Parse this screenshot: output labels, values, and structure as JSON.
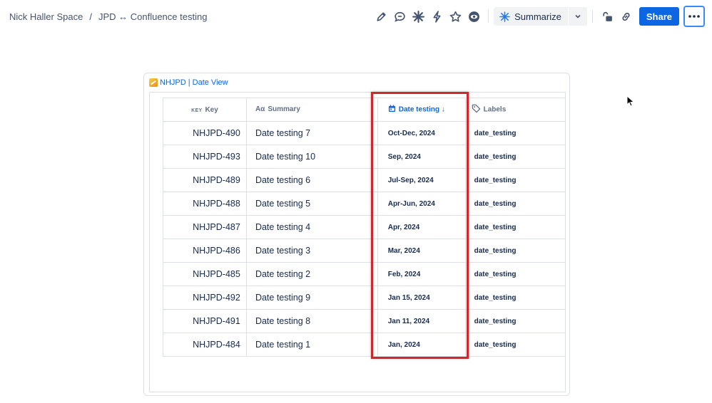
{
  "breadcrumb": {
    "space": "Nick Haller Space",
    "separator": "/",
    "page": "JPD ↔ Confluence testing"
  },
  "toolbar": {
    "summarize_label": "Summarize",
    "share_label": "Share"
  },
  "panel": {
    "title": "NHJPD | Date View",
    "columns": {
      "key_prefix": "KEY",
      "key": "Key",
      "summary_prefix": "Aα",
      "summary": "Summary",
      "date": "Date testing ↓",
      "labels": "Labels"
    },
    "rows": [
      {
        "key": "NHJPD-490",
        "summary": "Date testing 7",
        "date": "Oct-Dec, 2024",
        "label": "date_testing"
      },
      {
        "key": "NHJPD-493",
        "summary": "Date testing 10",
        "date": "Sep, 2024",
        "label": "date_testing"
      },
      {
        "key": "NHJPD-489",
        "summary": "Date testing 6",
        "date": "Jul-Sep, 2024",
        "label": "date_testing"
      },
      {
        "key": "NHJPD-488",
        "summary": "Date testing 5",
        "date": "Apr-Jun, 2024",
        "label": "date_testing"
      },
      {
        "key": "NHJPD-487",
        "summary": "Date testing 4",
        "date": "Apr, 2024",
        "label": "date_testing"
      },
      {
        "key": "NHJPD-486",
        "summary": "Date testing 3",
        "date": "Mar, 2024",
        "label": "date_testing"
      },
      {
        "key": "NHJPD-485",
        "summary": "Date testing 2",
        "date": "Feb, 2024",
        "label": "date_testing"
      },
      {
        "key": "NHJPD-492",
        "summary": "Date testing 9",
        "date": "Jan 15, 2024",
        "label": "date_testing"
      },
      {
        "key": "NHJPD-491",
        "summary": "Date testing 8",
        "date": "Jan 11, 2024",
        "label": "date_testing"
      },
      {
        "key": "NHJPD-484",
        "summary": "Date testing 1",
        "date": "Jan, 2024",
        "label": "date_testing"
      }
    ]
  },
  "colors": {
    "accent": "#0c66e4",
    "highlight": "#d3262a"
  }
}
